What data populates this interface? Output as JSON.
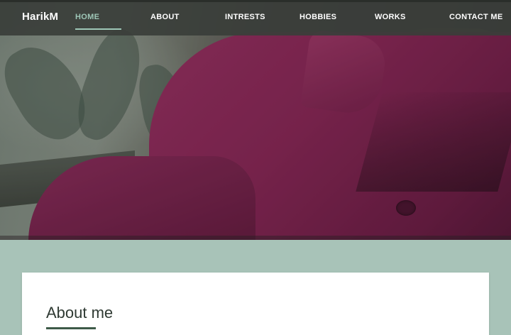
{
  "brand": {
    "name": "HarikM"
  },
  "nav": {
    "items": [
      {
        "label": "HOME",
        "active": true
      },
      {
        "label": "ABOUT",
        "active": false
      },
      {
        "label": "INTRESTS",
        "active": false
      },
      {
        "label": "HOBBIES",
        "active": false
      },
      {
        "label": "WORKS",
        "active": false
      },
      {
        "label": "CONTACT ME",
        "active": false
      }
    ]
  },
  "about": {
    "title": "About me"
  },
  "colors": {
    "navbar": "#3a3e3a",
    "nav_active": "#9ec7b7",
    "page_background": "#a8c3b8",
    "card": "#ffffff",
    "title_underline": "#3d5a48"
  }
}
